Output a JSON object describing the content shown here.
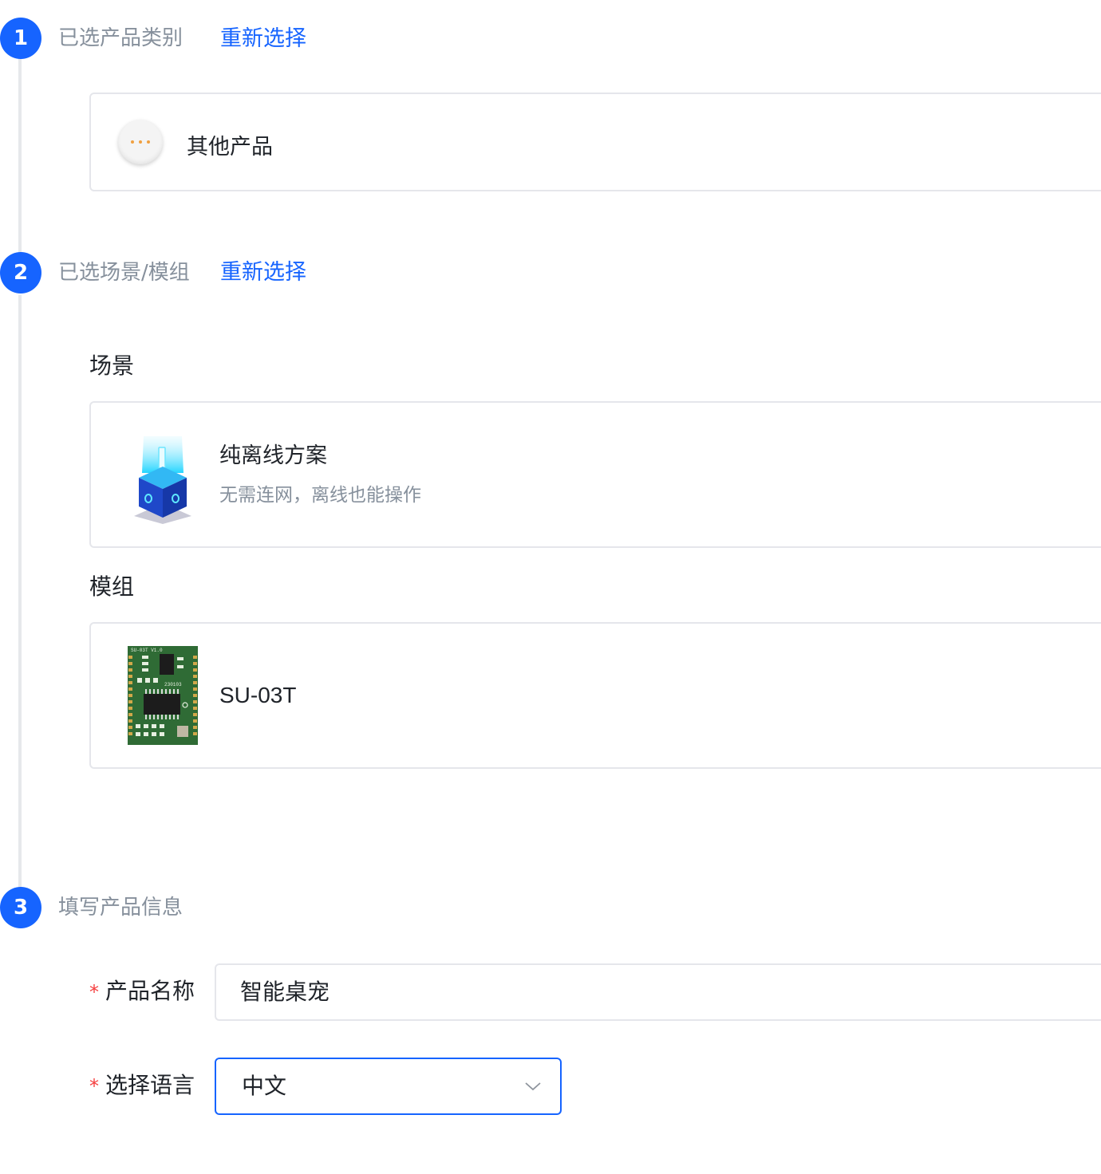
{
  "steps": [
    {
      "number": "1",
      "title": "已选产品类别",
      "action": "重新选择"
    },
    {
      "number": "2",
      "title": "已选场景/模组",
      "action": "重新选择"
    },
    {
      "number": "3",
      "title": "填写产品信息"
    }
  ],
  "category": {
    "name": "其他产品",
    "icon": "more-dots-icon"
  },
  "scene": {
    "section_label": "场景",
    "title": "纯离线方案",
    "description": "无需连网，离线也能操作",
    "icon": "offline-cube-icon"
  },
  "module": {
    "section_label": "模组",
    "name": "SU-03T",
    "board_print": "SU-03T V1.0",
    "board_code": "230103"
  },
  "form": {
    "required_mark": "*",
    "product_name_label": "产品名称",
    "product_name_value": "智能桌宠",
    "language_label": "选择语言",
    "language_value": "中文"
  },
  "colors": {
    "accent": "#1664ff",
    "muted_text": "#86909c",
    "border": "#e5e6eb",
    "required": "#f53f3f",
    "pcb_green": "#2f6b35"
  }
}
